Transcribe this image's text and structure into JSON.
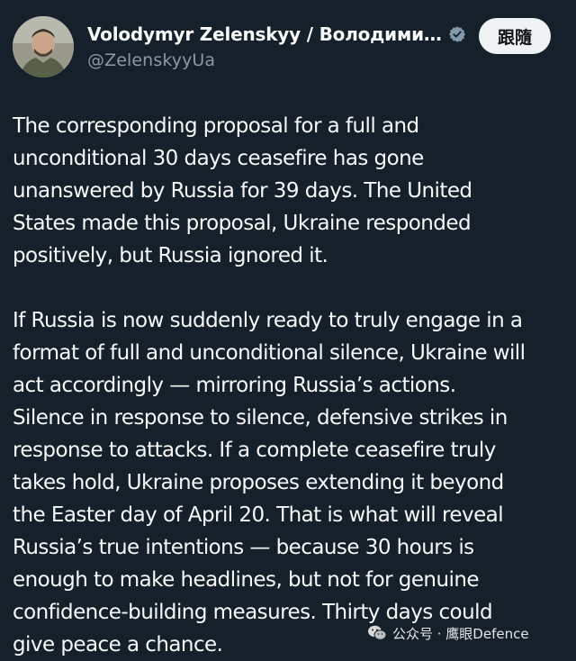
{
  "author": {
    "display_name": "Volodymyr Zelenskyy / Володими…",
    "handle": "@ZelenskyyUa",
    "verified_icon": "verified-badge-icon",
    "avatar_icon": "avatar-photo"
  },
  "follow_button": {
    "label": "跟隨"
  },
  "tweet": {
    "paragraphs": [
      {
        "lines": [
          "The corresponding proposal for a full and",
          "unconditional 30 days ceasefire has gone",
          "unanswered by Russia for 39 days. The United",
          "States made this proposal, Ukraine responded",
          "positively, but Russia ignored it."
        ]
      },
      {
        "lines": [
          "If Russia is now suddenly ready to truly engage in a",
          "format of full and unconditional silence, Ukraine will",
          "act accordingly — mirroring Russia’s actions.",
          "Silence in response to silence, defensive strikes in",
          "response to attacks. If a complete ceasefire truly",
          "takes hold, Ukraine proposes extending it beyond",
          "the Easter day of April 20. That is what will reveal",
          "Russia’s true intentions — because 30 hours is",
          "enough to make headlines, but not for genuine",
          "confidence-building measures. Thirty days could",
          "give peace a chance."
        ]
      }
    ]
  },
  "watermark": {
    "text": "公众号 · 鹰眼Defence",
    "icon": "wechat-icon"
  },
  "colors": {
    "background": "#15202b",
    "text_primary": "#f7f9f9",
    "text_secondary": "#8b98a5",
    "button_bg": "#eff3f4",
    "button_text": "#0f1419"
  }
}
